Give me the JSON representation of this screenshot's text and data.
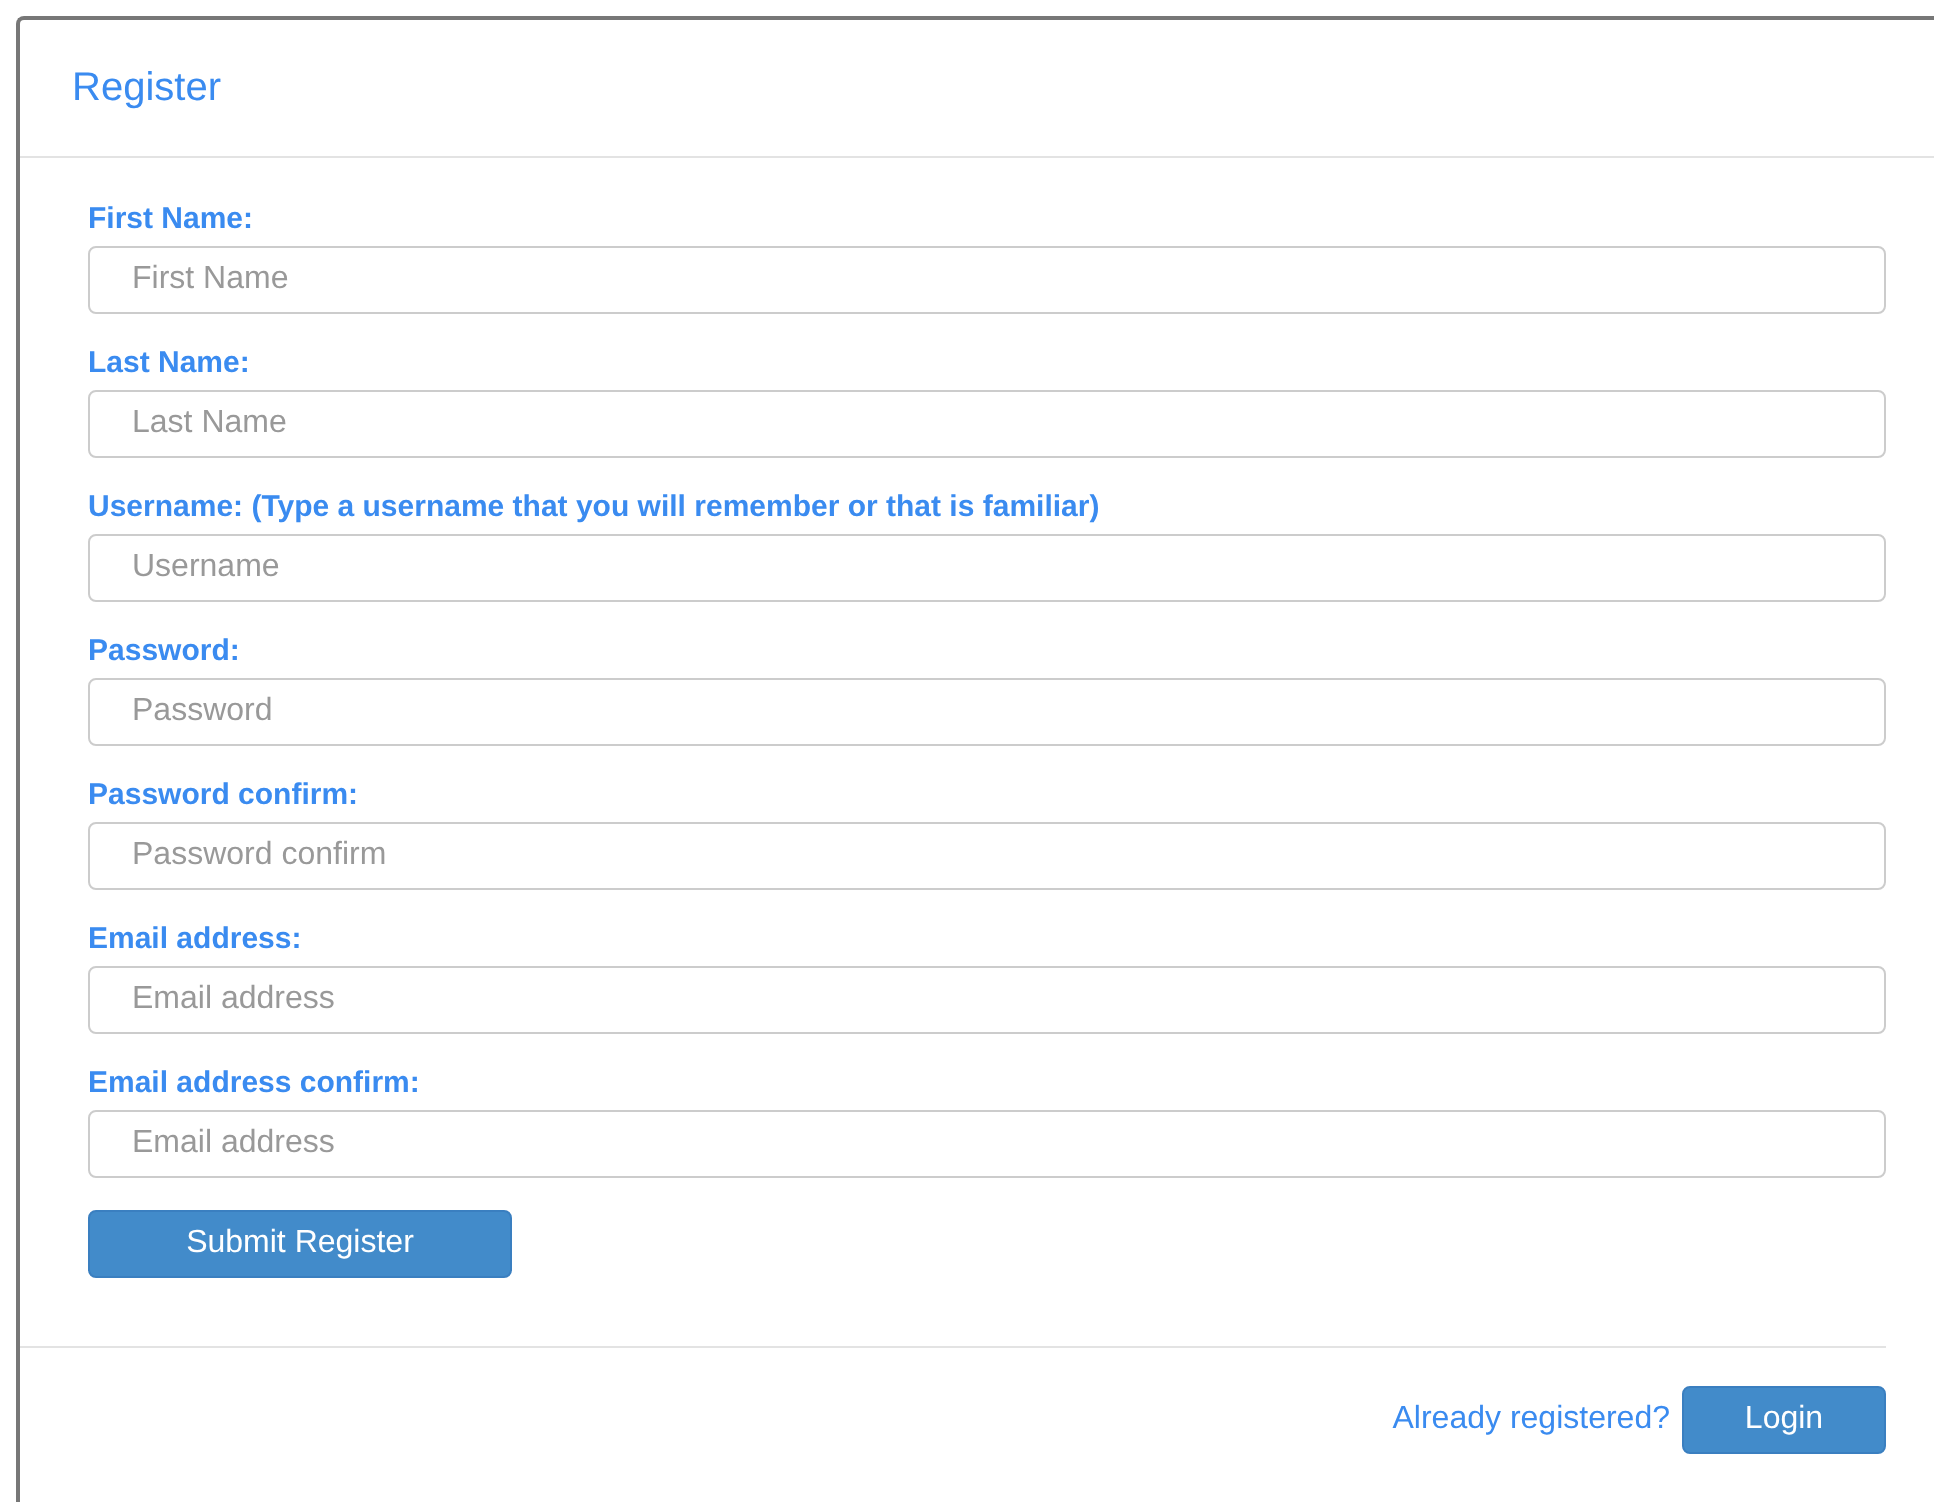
{
  "panel": {
    "title": "Register"
  },
  "fields": [
    {
      "label": "First Name:",
      "placeholder": "First Name"
    },
    {
      "label": "Last Name:",
      "placeholder": "Last Name"
    },
    {
      "label": "Username: (Type a username that you will remember or that is familiar)",
      "placeholder": "Username"
    },
    {
      "label": "Password:",
      "placeholder": "Password"
    },
    {
      "label": "Password confirm:",
      "placeholder": "Password confirm"
    },
    {
      "label": "Email address:",
      "placeholder": "Email address"
    },
    {
      "label": "Email address confirm:",
      "placeholder": "Email address"
    }
  ],
  "submit_button": "Submit Register",
  "footer": {
    "link": "Already registered?",
    "button": "Login"
  }
}
